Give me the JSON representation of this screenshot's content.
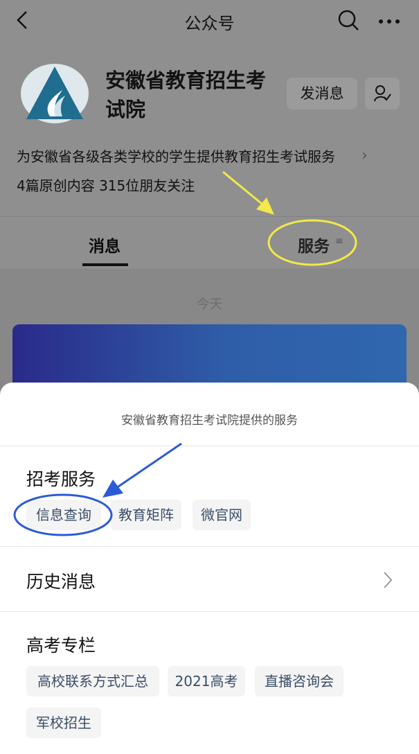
{
  "nav": {
    "title": "公众号"
  },
  "account": {
    "name": "安徽省教育招生考试院",
    "send_message": "发消息",
    "description": "为安徽省各级各类学校的学生提供教育招生考试服务",
    "stats": "4篇原创内容  315位朋友关注"
  },
  "tabs": {
    "messages": "消息",
    "services": "服务"
  },
  "feed": {
    "date": "今天"
  },
  "sheet": {
    "title": "安徽省教育招生考试院提供的服务",
    "sections": {
      "recruit": {
        "title": "招考服务",
        "items": [
          "信息查询",
          "教育矩阵",
          "微官网"
        ]
      },
      "history": {
        "title": "历史消息"
      },
      "gaokao": {
        "title": "高考专栏",
        "items": [
          "高校联系方式汇总",
          "2021高考",
          "直播咨询会",
          "军校招生"
        ]
      }
    }
  },
  "colors": {
    "annotation_yellow": "#f2e84a",
    "annotation_blue": "#2c5bd6",
    "logo_teal": "#1f6d8f"
  }
}
